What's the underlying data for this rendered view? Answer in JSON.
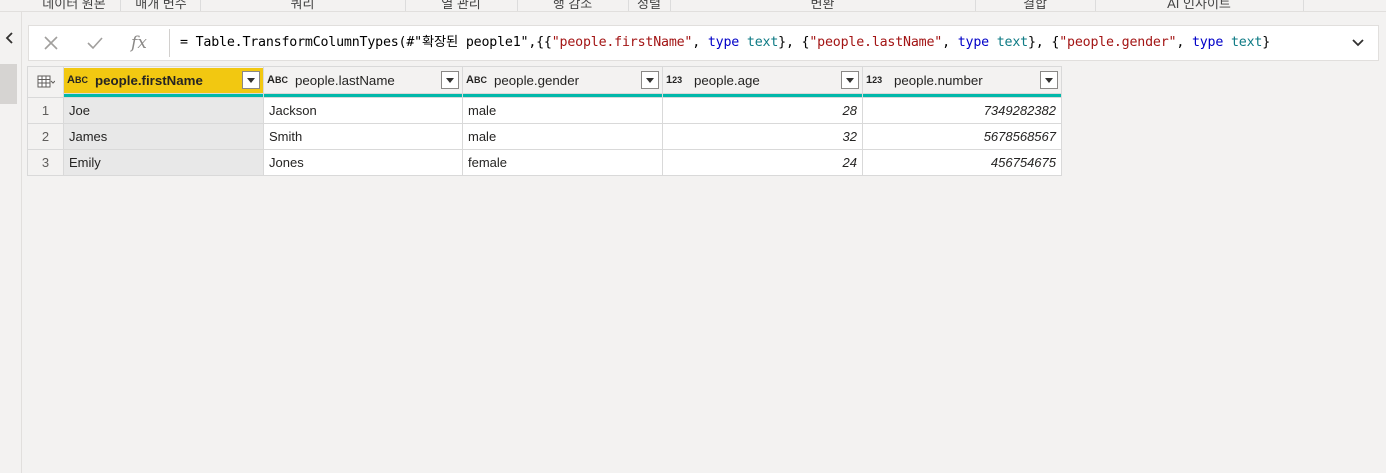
{
  "ribbon_groups": [
    "데이터 원본",
    "매개 변수",
    "쿼리",
    "열 관리",
    "행 감소",
    "정렬",
    "변환",
    "결합",
    "AI 인사이트"
  ],
  "formula_bar": {
    "cancel_icon": "x-icon",
    "confirm_icon": "check-icon",
    "fx_label": "fx",
    "formula_tokens": [
      {
        "t": "= Table.TransformColumnTypes(#\"확장된 people1\",{{",
        "k": "plain"
      },
      {
        "t": "\"people.firstName\"",
        "k": "str"
      },
      {
        "t": ", ",
        "k": "plain"
      },
      {
        "t": "type",
        "k": "kw"
      },
      {
        "t": " ",
        "k": "plain"
      },
      {
        "t": "text",
        "k": "type"
      },
      {
        "t": "}, {",
        "k": "plain"
      },
      {
        "t": "\"people.lastName\"",
        "k": "str"
      },
      {
        "t": ", ",
        "k": "plain"
      },
      {
        "t": "type",
        "k": "kw"
      },
      {
        "t": " ",
        "k": "plain"
      },
      {
        "t": "text",
        "k": "type"
      },
      {
        "t": "}, {",
        "k": "plain"
      },
      {
        "t": "\"people.gender\"",
        "k": "str"
      },
      {
        "t": ", ",
        "k": "plain"
      },
      {
        "t": "type",
        "k": "kw"
      },
      {
        "t": " ",
        "k": "plain"
      },
      {
        "t": "text",
        "k": "type"
      },
      {
        "t": "}",
        "k": "plain"
      }
    ]
  },
  "table": {
    "columns": [
      {
        "name": "people.firstName",
        "type_icon": "ABC",
        "kind": "text",
        "selected": true
      },
      {
        "name": "people.lastName",
        "type_icon": "ABC",
        "kind": "text",
        "selected": false
      },
      {
        "name": "people.gender",
        "type_icon": "ABC",
        "kind": "text",
        "selected": false
      },
      {
        "name": "people.age",
        "type_icon": "123",
        "kind": "number",
        "selected": false
      },
      {
        "name": "people.number",
        "type_icon": "123",
        "kind": "number",
        "selected": false
      }
    ],
    "rows": [
      {
        "num": "1",
        "cells": [
          "Joe",
          "Jackson",
          "male",
          "28",
          "7349282382"
        ]
      },
      {
        "num": "2",
        "cells": [
          "James",
          "Smith",
          "male",
          "32",
          "5678568567"
        ]
      },
      {
        "num": "3",
        "cells": [
          "Emily",
          "Jones",
          "female",
          "24",
          "456754675"
        ]
      }
    ]
  },
  "colors": {
    "selected_header": "#f2c811",
    "quality_bar": "#01b8aa",
    "string": "#a31515",
    "keyword": "#0000c8",
    "type": "#0f7b85"
  }
}
